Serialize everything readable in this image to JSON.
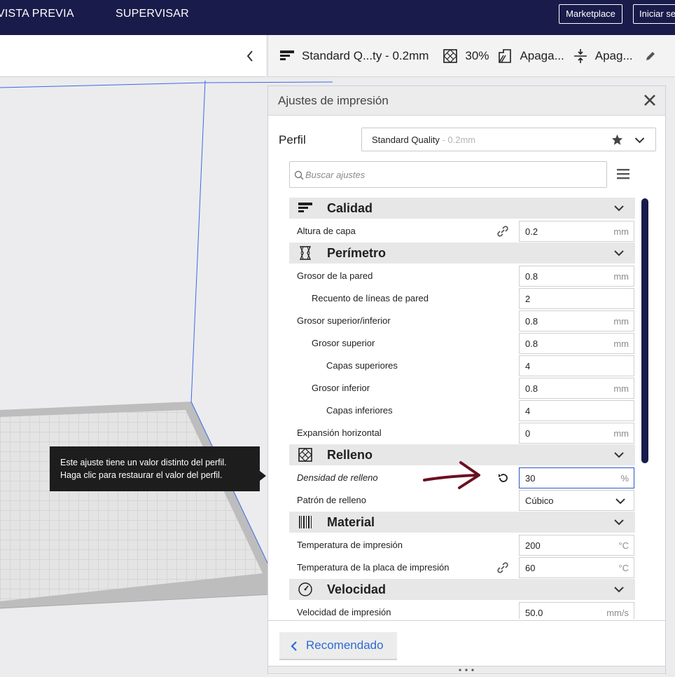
{
  "topbar": {
    "nav_preview": "VISTA PREVIA",
    "nav_monitor": "SUPERVISAR",
    "marketplace": "Marketplace",
    "signin": "Iniciar se"
  },
  "summary": {
    "profile": "Standard Q...ty - 0.2mm",
    "infill": "30%",
    "support": "Apaga...",
    "adhesion": "Apag..."
  },
  "panel": {
    "title": "Ajustes de impresión",
    "profile_label": "Perfil",
    "profile_value": "Standard Quality",
    "profile_sub": " - 0.2mm",
    "search_placeholder": "Buscar ajustes"
  },
  "categories": {
    "quality": "Calidad",
    "walls": "Perímetro",
    "infill": "Relleno",
    "material": "Material",
    "speed": "Velocidad"
  },
  "settings": {
    "layer_height": {
      "label": "Altura de capa",
      "value": "0.2",
      "unit": "mm"
    },
    "wall_thickness": {
      "label": "Grosor de la pared",
      "value": "0.8",
      "unit": "mm"
    },
    "wall_line_count": {
      "label": "Recuento de líneas de pared",
      "value": "2",
      "unit": ""
    },
    "top_bottom_thickness": {
      "label": "Grosor superior/inferior",
      "value": "0.8",
      "unit": "mm"
    },
    "top_thickness": {
      "label": "Grosor superior",
      "value": "0.8",
      "unit": "mm"
    },
    "top_layers": {
      "label": "Capas superiores",
      "value": "4",
      "unit": ""
    },
    "bottom_thickness": {
      "label": "Grosor inferior",
      "value": "0.8",
      "unit": "mm"
    },
    "bottom_layers": {
      "label": "Capas inferiores",
      "value": "4",
      "unit": ""
    },
    "horizontal_expansion": {
      "label": "Expansión horizontal",
      "value": "0",
      "unit": "mm"
    },
    "infill_density": {
      "label": "Densidad de relleno",
      "value": "30",
      "unit": "%"
    },
    "infill_pattern": {
      "label": "Patrón de relleno",
      "value": "Cúbico"
    },
    "print_temp": {
      "label": "Temperatura de impresión",
      "value": "200",
      "unit": "°C"
    },
    "bed_temp": {
      "label": "Temperatura de la placa de impresión",
      "value": "60",
      "unit": "°C"
    },
    "print_speed": {
      "label": "Velocidad de impresión",
      "value": "50.0",
      "unit": "mm/s"
    }
  },
  "footer": {
    "recommended": "Recomendado"
  },
  "tooltip": {
    "line1": "Este ajuste tiene un valor distinto del perfil.",
    "line2": "Haga clic para restaurar el valor del perfil."
  },
  "colors": {
    "header": "#191b4a",
    "accent": "#2d6bd5",
    "annotation_arrow": "#6b1020"
  }
}
